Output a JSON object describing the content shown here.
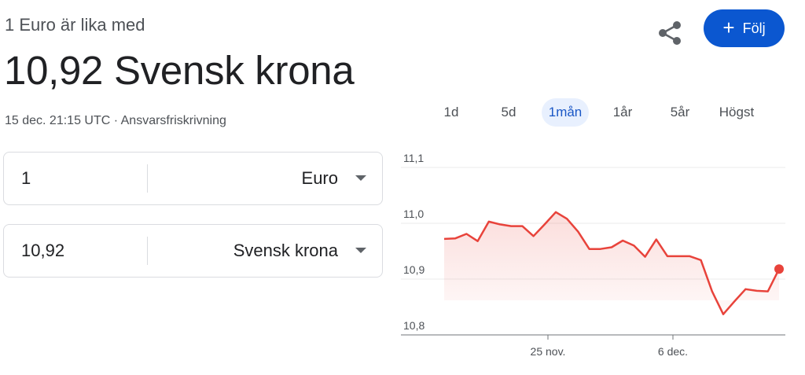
{
  "header": {
    "subtitle": "1 Euro är lika med",
    "rate": "10,92 Svensk krona",
    "meta": "15 dec. 21:15 UTC · Ansvarsfriskrivning",
    "share_icon": "share-icon",
    "follow_label": "Följ",
    "accent": "#0b57d0"
  },
  "converter": {
    "from": {
      "value": "1",
      "currency": "Euro"
    },
    "to": {
      "value": "10,92",
      "currency": "Svensk krona"
    }
  },
  "tabs": [
    {
      "label": "1d",
      "active": false
    },
    {
      "label": "5d",
      "active": false
    },
    {
      "label": "1mån",
      "active": true
    },
    {
      "label": "1år",
      "active": false
    },
    {
      "label": "5år",
      "active": false
    },
    {
      "label": "Högst",
      "active": false
    }
  ],
  "chart_data": {
    "type": "area",
    "x": [
      0,
      1,
      2,
      3,
      4,
      5,
      6,
      7,
      8,
      9,
      10,
      11,
      12,
      13,
      14,
      15,
      16,
      17,
      18,
      19,
      20,
      21,
      22,
      23,
      24,
      25,
      26,
      27,
      28,
      29,
      30,
      31
    ],
    "values": [
      10.972,
      10.973,
      10.981,
      10.968,
      11.003,
      10.998,
      10.995,
      10.995,
      10.977,
      10.998,
      11.02,
      11.008,
      10.985,
      10.954,
      10.954,
      10.957,
      10.969,
      10.96,
      10.94,
      10.971,
      10.941,
      10.941,
      10.941,
      10.934,
      10.878,
      10.837,
      10.86,
      10.882,
      10.879,
      10.878,
      10.918
    ],
    "x_tick_labels": [
      "25 nov.",
      "6 dec."
    ],
    "y_tick_labels": [
      "11,1",
      "11,0",
      "10,9",
      "10,8"
    ],
    "ylim": [
      10.8,
      11.1
    ],
    "line_color": "#e8433b",
    "grid": true
  }
}
